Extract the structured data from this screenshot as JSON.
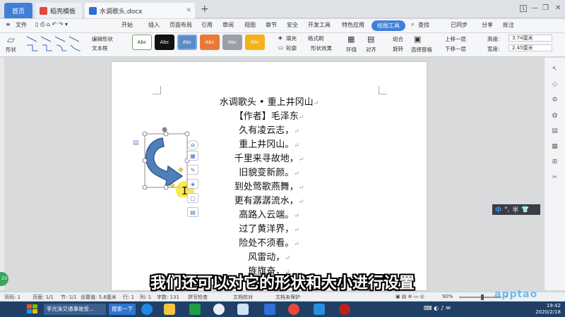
{
  "tabs": {
    "home": "首页",
    "template": "稻壳模板",
    "document": "水调歌头.docx",
    "new": "+"
  },
  "window": {
    "badge": "1"
  },
  "menu": {
    "file": "文件",
    "items": [
      "开始",
      "插入",
      "页面布局",
      "引用",
      "审阅",
      "视图",
      "章节",
      "安全",
      "开发工具",
      "特色应用"
    ],
    "active": "绘图工具",
    "search": "查找",
    "sync": "已同步",
    "share": "分享",
    "comment": "批注"
  },
  "ribbon": {
    "shape": "形状",
    "edit_shape": "编辑形状",
    "textbox": "文本框",
    "style_label": "Abc",
    "fill": "填充",
    "format_brush": "格式刷",
    "outline": "轮廓",
    "shape_effect": "形状效果",
    "wrap": "环绕",
    "align": "对齐",
    "group": "组合",
    "rotate": "旋转",
    "select_pane": "选择窗格",
    "bring_forward": "上移一层",
    "send_backward": "下移一层",
    "height_label": "高度:",
    "height_value": "3.74厘米",
    "width_label": "宽度:",
    "width_value": "2.45厘米"
  },
  "poem": [
    "水调歌头 • 重上井冈山",
    "【作者】毛泽东",
    "久有凌云志，",
    "重上井冈山。",
    "千里来寻故地，",
    "旧貌变新颜。",
    "到处莺歌燕舞，",
    "更有潺潺流水，",
    "高路入云端。",
    "过了黄洋界，",
    "险处不须看。",
    "风雷动，",
    "旌旗奋，"
  ],
  "ime": {
    "lang": "中",
    "punct": "°,",
    "width": "半"
  },
  "subtitle": "我们还可以对它的形状和大小进行设置",
  "status": {
    "page": "页码: 1",
    "pages": "页面: 1/1",
    "section": "节: 1/1",
    "position": "设置值: 5.8厘米",
    "row": "行: 1",
    "col": "列: 1",
    "words": "字数: 131",
    "spell": "拼写检查",
    "proof": "文档校对",
    "protect": "文档未保护",
    "zoom": "90%",
    "zoom_fraction": 0.55
  },
  "taskbar": {
    "window1": "李光洙交通事故受...",
    "search": "搜索一下",
    "time": "19:42",
    "date": "2020/2/18"
  },
  "side_badge": "23",
  "brand": "apptao",
  "colors": {
    "accent": "#3f7fd8",
    "shape_fill": "#4f7fb6",
    "shape_stroke": "#2f5f96",
    "handle": "#f2e04a",
    "cursor_highlight": "#f6e11a"
  }
}
